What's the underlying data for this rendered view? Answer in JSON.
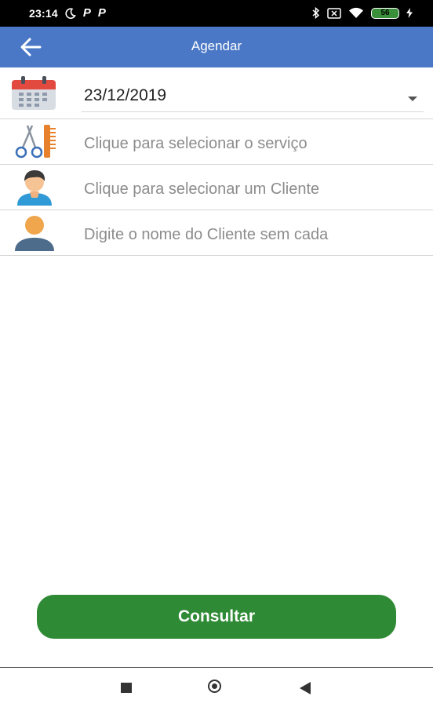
{
  "status_bar": {
    "time": "23:14",
    "notification_1": "P",
    "notification_2": "P",
    "battery": "56"
  },
  "app_bar": {
    "title": "Agendar",
    "back_icon": "arrow-left-icon"
  },
  "form": {
    "date": {
      "value": "23/12/2019",
      "icon": "calendar-icon"
    },
    "service": {
      "placeholder": "Clique para selecionar o serviço",
      "icon": "scissors-comb-icon"
    },
    "client_select": {
      "placeholder": "Clique para selecionar um Cliente",
      "icon": "client-avatar-icon"
    },
    "client_name": {
      "placeholder": "Digite o nome do Cliente sem cada",
      "icon": "person-silhouette-icon"
    }
  },
  "actions": {
    "consult_label": "Consultar"
  },
  "colors": {
    "app_bar": "#4a78c6",
    "button": "#2f8a35",
    "battery": "#3a8f3a"
  }
}
